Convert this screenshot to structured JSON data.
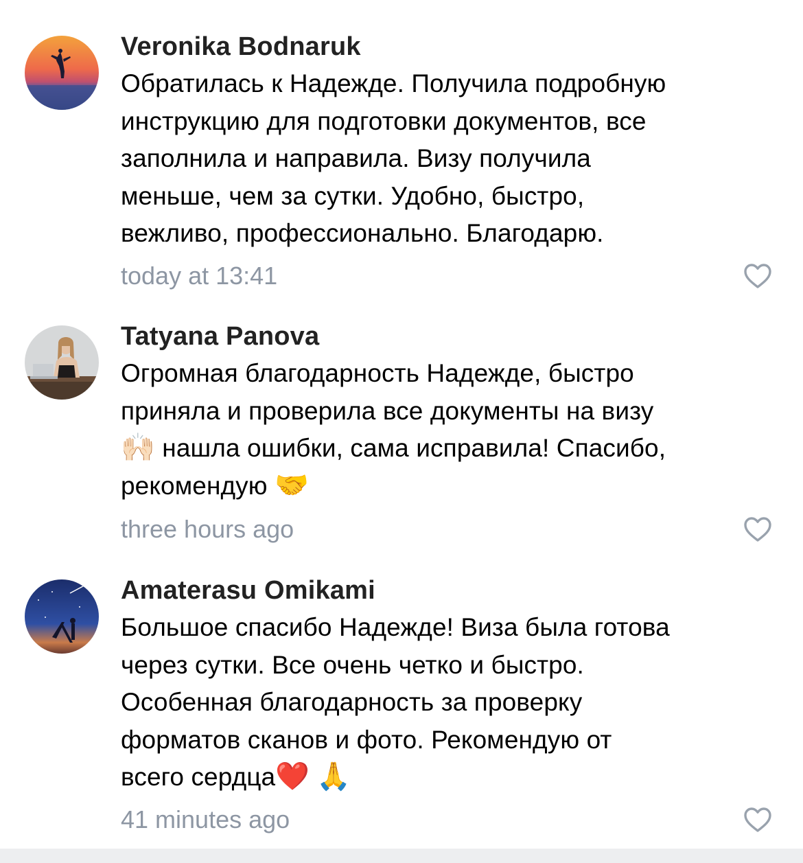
{
  "comments": [
    {
      "author": "Veronika Bodnaruk",
      "text_lines": [
        "Обратилась к Надежде. Получила подробную",
        "инструкцию для подготовки документов, все",
        "заполнила и направила. Визу получила",
        "меньше, чем за сутки. Удобно, быстро,",
        "вежливо, профессионально. Благодарю."
      ],
      "timestamp": "today at 13:41",
      "avatar_icon": "sunset-silhouette-avatar",
      "like_icon": "heart-outline-icon"
    },
    {
      "author": "Tatyana Panova",
      "text_lines": [
        "Огромная благодарность Надежде, быстро",
        "приняла и проверила все документы на визу",
        " нашла ошибки, сама исправила! Спасибо,",
        "рекомендую "
      ],
      "emoji_raised_hands": "🙌🏻",
      "emoji_handshake": "🤝",
      "timestamp": "three hours ago",
      "avatar_icon": "woman-laptop-avatar",
      "like_icon": "heart-outline-icon"
    },
    {
      "author": "Amaterasu Omikami",
      "text_lines": [
        "Большое спасибо Надежде! Виза была готова",
        "через сутки. Все очень четко и быстро.",
        "Особенная благодарность за проверку",
        "форматов сканов и фото. Рекомендую от",
        "всего сердца"
      ],
      "emoji_heart": "❤️",
      "emoji_pray": "🙏",
      "timestamp": "41 minutes ago",
      "avatar_icon": "night-sky-avatar",
      "like_icon": "heart-outline-icon"
    }
  ],
  "colors": {
    "author": "#222222",
    "text": "#000000",
    "meta": "#8d96a3",
    "like_outline": "#99a2ad",
    "footer_bar": "#edeef0"
  }
}
